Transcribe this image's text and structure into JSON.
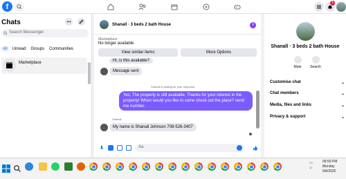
{
  "topbar": {
    "logo": "f",
    "icons": [
      "search-icon",
      "home-icon",
      "groups-icon",
      "marketplace-icon",
      "watch-icon",
      "gaming-icon"
    ],
    "notification_count": "1"
  },
  "left_panel": {
    "title": "Chats",
    "search_placeholder": "Search Messenger",
    "filters": [
      "All",
      "Unread",
      "Groups",
      "Communities"
    ],
    "items": [
      {
        "label": "Marketplace"
      }
    ]
  },
  "conversation": {
    "title": "Shanall · 3 beds 2 bath House",
    "info_label": "i",
    "marketplace_small": "Marketplace",
    "listing_status": "No longer available",
    "view_similar": "View similar items",
    "more_options": "More Options",
    "messages": [
      {
        "text": "Hi, is this available?",
        "sender": "other"
      },
      {
        "text": "Message sent",
        "sender": "other"
      },
      {
        "text": "Shanall is waiting for your response.",
        "sender": "system"
      },
      {
        "text": "Yes, The property is still available. Thanks for your interest in the property! When would you like to come check out the place? send me number.",
        "sender": "me"
      },
      {
        "text": "Shanall",
        "sender": "system"
      },
      {
        "text": "My name is Shanall Johnson 708-526-3407",
        "sender": "other"
      }
    ],
    "compose_placeholder": "Aa"
  },
  "right_panel": {
    "name": "Shanall · 3 beds 2 bath House",
    "actions": [
      {
        "label": "Mute"
      },
      {
        "label": "Search"
      }
    ],
    "sections": [
      "Customise chat",
      "Chat members",
      "Media, files and links",
      "Privacy & support"
    ]
  },
  "taskbar": {
    "time": "09:59 PM",
    "day": "Monday",
    "date": "6/8/2020"
  },
  "colors": {
    "brand": "#1877f2",
    "outgoing_bubble": "#7b5cff",
    "info_dot": "#8a3ffc"
  }
}
